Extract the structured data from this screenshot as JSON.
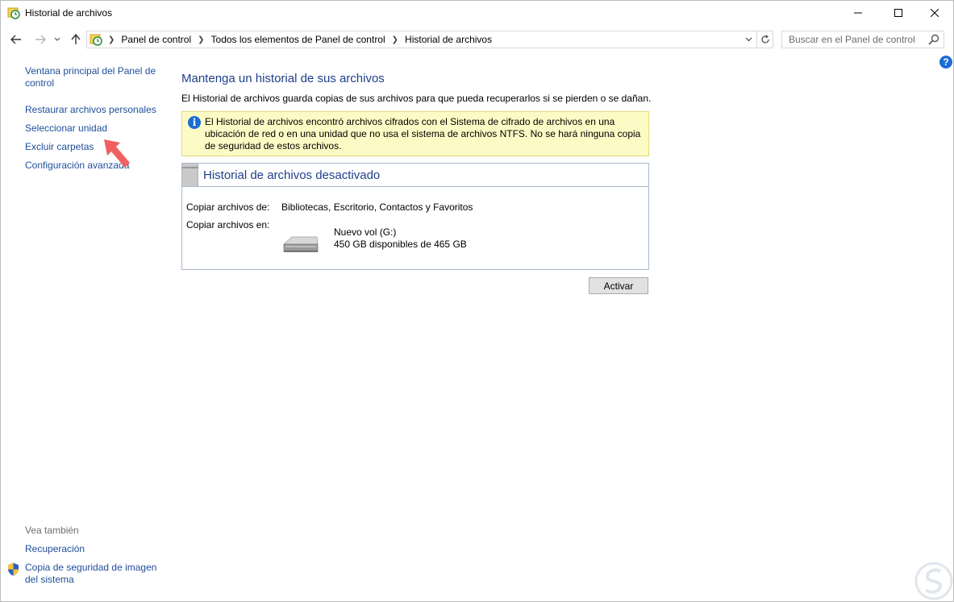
{
  "window": {
    "title": "Historial de archivos"
  },
  "address_bar": {
    "breadcrumbs": [
      "Panel de control",
      "Todos los elementos de Panel de control",
      "Historial de archivos"
    ]
  },
  "search": {
    "placeholder": "Buscar en el Panel de control"
  },
  "sidebar": {
    "links": [
      {
        "label": "Ventana principal del Panel de control"
      },
      {
        "label": "Restaurar archivos personales"
      },
      {
        "label": "Seleccionar unidad"
      },
      {
        "label": "Excluir carpetas"
      },
      {
        "label": "Configuración avanzada"
      }
    ],
    "see_also_label": "Vea también",
    "see_also_links": [
      {
        "label": "Recuperación"
      },
      {
        "label": "Copia de seguridad de imagen del sistema"
      }
    ]
  },
  "main": {
    "title": "Mantenga un historial de sus archivos",
    "description": "El Historial de archivos guarda copias de sus archivos para que pueda recuperarlos si se pierden o se dañan.",
    "warning": "El Historial de archivos encontró archivos cifrados con el Sistema de cifrado de archivos en una ubicación de red o en una unidad que no usa el sistema de archivos NTFS. No se hará ninguna copia de seguridad de estos archivos.",
    "status_panel": {
      "title": "Historial de archivos desactivado",
      "copy_from_label": "Copiar archivos de:",
      "copy_from_value": "Bibliotecas, Escritorio, Contactos y Favoritos",
      "copy_to_label": "Copiar archivos en:",
      "drive_name": "Nuevo vol (G:)",
      "drive_space": "450 GB disponibles de 465 GB"
    },
    "activate_button": "Activar"
  },
  "colors": {
    "link": "#1e4e9a",
    "heading": "#1e3f8a",
    "warning_bg": "#fdfbc5",
    "info_blue": "#1c6cd3",
    "annotation_arrow": "#f06060"
  },
  "icons": {
    "app": "file-history-icon",
    "back": "back-arrow-icon",
    "forward": "forward-arrow-icon",
    "recent": "chevron-down-icon",
    "up": "up-arrow-icon",
    "refresh": "refresh-icon",
    "search": "search-icon",
    "help": "help-icon",
    "info": "info-icon",
    "drive": "hard-drive-icon",
    "shield": "uac-shield-icon"
  }
}
